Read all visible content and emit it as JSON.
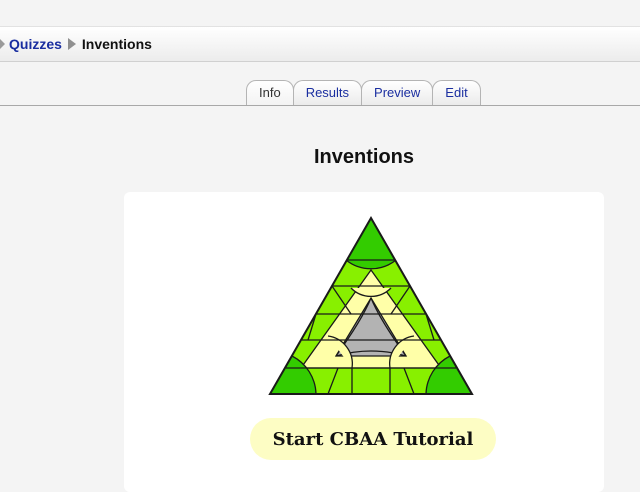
{
  "breadcrumb": {
    "link": "Quizzes",
    "current": "Inventions"
  },
  "tabs": [
    {
      "label": "Info",
      "active": true
    },
    {
      "label": "Results",
      "active": false
    },
    {
      "label": "Preview",
      "active": false
    },
    {
      "label": "Edit",
      "active": false
    }
  ],
  "page": {
    "title": "Inventions"
  },
  "start_button": {
    "label": "Start CBAA Tutorial"
  },
  "colors": {
    "link": "#1a2ea0",
    "button_bg": "#fdfdc4",
    "green_dark": "#33cc00",
    "green_light": "#88f000",
    "yellow": "#ffffa8",
    "gray": "#b3b3b3"
  },
  "icons": [
    "triangle-logo-icon",
    "breadcrumb-arrow-icon"
  ]
}
